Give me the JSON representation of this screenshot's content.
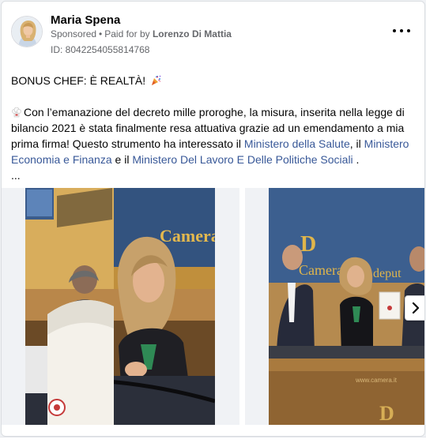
{
  "post": {
    "author": "Maria Spena",
    "sponsored_label": "Sponsored",
    "separator": "•",
    "paid_for_prefix": "Paid for by",
    "payer": "Lorenzo Di Mattia",
    "ad_id": "ID: 8042254055814768",
    "headline": "BONUS CHEF: È REALTÀ!",
    "body_part1": "Con l’emanazione del decreto mille proroghe, la misura, inserita nella legge di bilancio 2021 è stata finalmente resa attuativa grazie ad un emendamento a mia prima firma! Questo strumento ha interessato il ",
    "link1": "Ministero della Salute",
    "body_part2": ", il ",
    "link2": "Ministero Economia e Finanza",
    "body_part3": " e il ",
    "link3": "Ministero Del Lavoro E Delle Politiche Sociali",
    "body_part4": " .",
    "ellipsis": "..."
  },
  "images": {
    "slide1_sign": "Camera",
    "slide2_sign_left": "Camera",
    "slide2_sign_right": "deput",
    "slide2_bottom_text": "www.camera.it"
  },
  "icons": {
    "more": "more-horizontal-icon",
    "party": "party-popper-icon",
    "chef": "chef-hat-icon",
    "next": "chevron-right-icon"
  },
  "colors": {
    "link": "#385898",
    "meta": "#65676b",
    "background": "#f0f2f5"
  }
}
